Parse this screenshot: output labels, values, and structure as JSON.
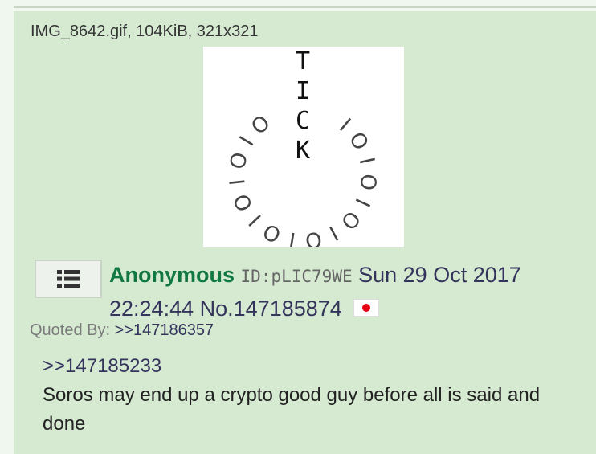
{
  "file": {
    "info": "IMG_8642.gif, 104KiB, 321x321",
    "thumbnail_letters": {
      "vertical": [
        "T",
        "I",
        "C",
        "K"
      ],
      "ring": "IOIOIOIOIOIOIOIO"
    }
  },
  "post": {
    "name": "Anonymous",
    "id_label": "ID:pLIC79WE",
    "datetime": "Sun 29 Oct 2017 22:24:44",
    "number": "No.147185874",
    "flag": "japan-flag"
  },
  "quoted_by": {
    "label": "Quoted By: ",
    "link": ">>147186357"
  },
  "message": {
    "quote": ">>147185233",
    "text": "Soros may end up a crypto good guy before all is said and done"
  },
  "colors": {
    "post_bg": "#d6ead2",
    "name": "#117743",
    "link": "#34345c",
    "flag_red": "#e60012"
  }
}
